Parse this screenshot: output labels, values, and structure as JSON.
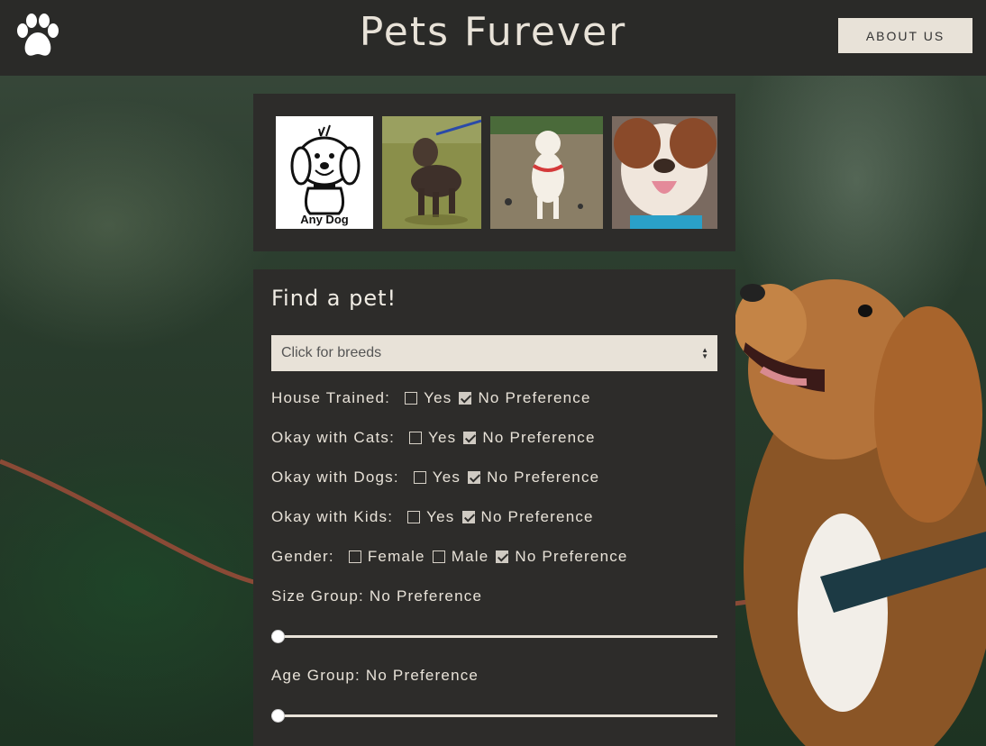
{
  "header": {
    "title": "Pets Furever",
    "about_label": "ABOUT US",
    "logo_icon": "paw-icon"
  },
  "photos": {
    "items": [
      {
        "name": "any-dog",
        "caption": "Any Dog"
      },
      {
        "name": "brindle-dog"
      },
      {
        "name": "white-dog"
      },
      {
        "name": "pitbull-dog"
      }
    ]
  },
  "filters": {
    "heading": "Find a pet!",
    "breed_placeholder": "Click for breeds",
    "house_trained": {
      "label": "House Trained:",
      "yes": "Yes",
      "no_pref": "No Preference",
      "selected": "no_pref"
    },
    "cats": {
      "label": "Okay with Cats:",
      "yes": "Yes",
      "no_pref": "No Preference",
      "selected": "no_pref"
    },
    "dogs": {
      "label": "Okay with Dogs:",
      "yes": "Yes",
      "no_pref": "No Preference",
      "selected": "no_pref"
    },
    "kids": {
      "label": "Okay with Kids:",
      "yes": "Yes",
      "no_pref": "No Preference",
      "selected": "no_pref"
    },
    "gender": {
      "label": "Gender:",
      "female": "Female",
      "male": "Male",
      "no_pref": "No Preference",
      "selected": "no_pref"
    },
    "size": {
      "label": "Size Group: No Preference",
      "value": 0
    },
    "age": {
      "label": "Age Group: No Preference",
      "value": 0
    }
  },
  "colors": {
    "header_bg": "#2a2a28",
    "panel_bg": "#2d2c2a",
    "cream": "#e8e2d8"
  }
}
